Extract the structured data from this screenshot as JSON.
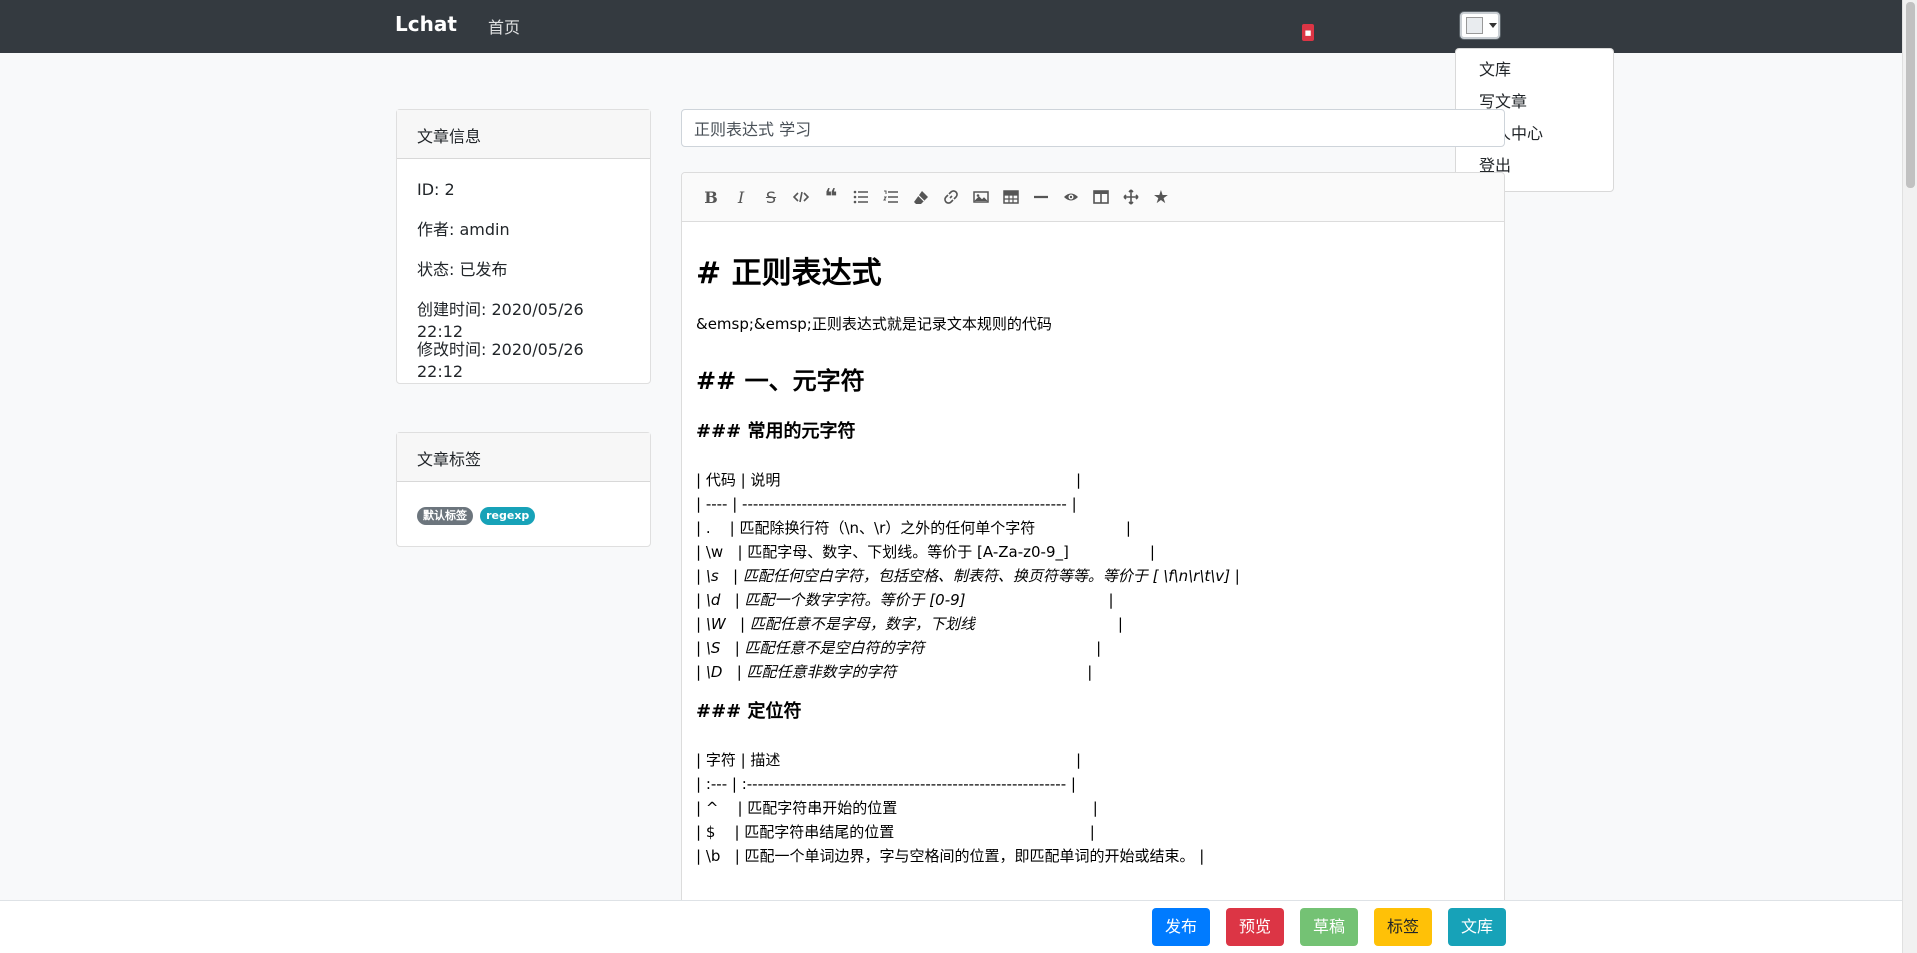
{
  "navbar": {
    "brand": "Lchat",
    "home": "首页",
    "dropdown": [
      "文库",
      "写文章",
      "个人中心",
      "登出"
    ]
  },
  "info_card": {
    "title": "文章信息",
    "rows": [
      "ID: 2",
      "作者: amdin",
      "状态: 已发布",
      "创建时间: 2020/05/26 22:12",
      "修改时间: 2020/05/26 22:12"
    ]
  },
  "tags_card": {
    "title": "文章标签",
    "tags": [
      "默认标签",
      "regexp"
    ]
  },
  "editor": {
    "title_value": "正则表达式 学习",
    "toolbar_icons": [
      "bold-icon",
      "italic-icon",
      "strikethrough-icon",
      "code-icon",
      "quote-icon",
      "unordered-list-icon",
      "ordered-list-icon",
      "eraser-icon",
      "link-icon",
      "image-icon",
      "table-icon",
      "horizontal-rule-icon",
      "preview-icon",
      "side-by-side-icon",
      "fullscreen-icon",
      "star-icon"
    ],
    "h1": "# 正则表达式",
    "intro": "&emsp;&emsp;正则表达式就是记录文本规则的代码",
    "h2": "## 一、元字符",
    "h3_common": "### 常用的元字符",
    "table1": [
      "| 代码 | 说明                                                              |",
      "| ---- | ------------------------------------------------------------ |",
      "| .    | 匹配除换行符（\\n、\\r）之外的任何单个字符                   |",
      "| \\w   | 匹配字母、数字、下划线。等价于 [A-Za-z0-9_]                 |",
      "| \\s   | 匹配任何空白字符，包括空格、制表符、换页符等等。等价于 [ \\f\\n\\r\\t\\v] |",
      "| \\d   | 匹配一个数字字符。等价于 [0-9]                              |",
      "| \\W   | 匹配任意不是字母，数字，下划线                              |",
      "| \\S   | 匹配任意不是空白符的字符                                    |",
      "| \\D   | 匹配任意非数字的字符                                        |"
    ],
    "h3_anchor": "### 定位符",
    "table2": [
      "| 字符 | 描述                                                              |",
      "| :--- | :----------------------------------------------------------- |",
      "| ^    | 匹配字符串开始的位置                                         |",
      "| $    | 匹配字符串结尾的位置                                         |",
      "| \\b   | 匹配一个单词边界，字与空格间的位置，即匹配单词的开始或结束。 |"
    ]
  },
  "bottom": {
    "publish": "发布",
    "preview": "预览",
    "draft": "草稿",
    "tags": "标签",
    "library": "文库"
  }
}
